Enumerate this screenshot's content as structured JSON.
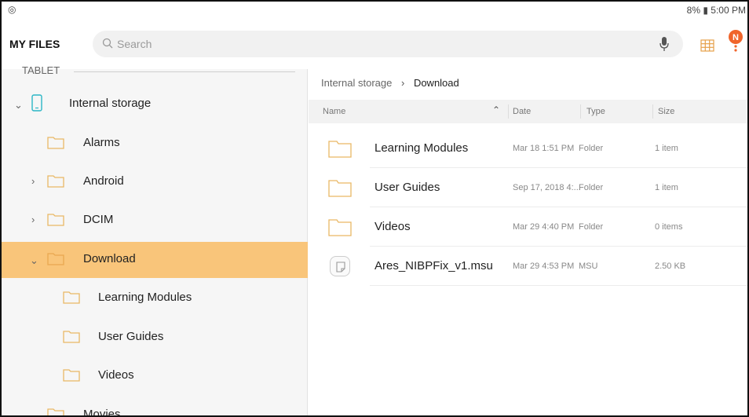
{
  "status_bar": {
    "left_icon": "refresh-icon",
    "battery": "8%",
    "time": "5:00 PM"
  },
  "app_bar": {
    "title": "MY FILES",
    "search_placeholder": "Search",
    "avatar_letter": "N"
  },
  "sidebar": {
    "section_label": "TABLET",
    "items": [
      {
        "label": "Internal storage",
        "expand": "expanded"
      },
      {
        "label": "Alarms",
        "expand": "none"
      },
      {
        "label": "Android",
        "expand": "collapsed"
      },
      {
        "label": "DCIM",
        "expand": "collapsed"
      },
      {
        "label": "Download",
        "expand": "expanded",
        "selected": true
      },
      {
        "label": "Learning Modules",
        "expand": "none"
      },
      {
        "label": "User Guides",
        "expand": "none"
      },
      {
        "label": "Videos",
        "expand": "none"
      },
      {
        "label": "Movies",
        "expand": "none"
      }
    ]
  },
  "breadcrumb": {
    "root": "Internal storage",
    "current": "Download"
  },
  "columns": {
    "name": "Name",
    "date": "Date",
    "type": "Type",
    "size": "Size"
  },
  "files": [
    {
      "name": "Learning Modules",
      "date": "Mar 18 1:51 PM",
      "type": "Folder",
      "size": "1 item",
      "icon": "folder-icon"
    },
    {
      "name": "User Guides",
      "date": "Sep 17, 2018 4:...",
      "type": "Folder",
      "size": "1 item",
      "icon": "folder-icon"
    },
    {
      "name": "Videos",
      "date": "Mar 29 4:40 PM",
      "type": "Folder",
      "size": "0 items",
      "icon": "folder-icon"
    },
    {
      "name": "Ares_NIBPFix_v1.msu",
      "date": "Mar 29 4:53 PM",
      "type": "MSU",
      "size": "2.50 KB",
      "icon": "file-icon"
    }
  ],
  "colors": {
    "accent": "#f9c57a",
    "folder_outline": "#e9b865",
    "avatar_orange": "#f0642a"
  }
}
